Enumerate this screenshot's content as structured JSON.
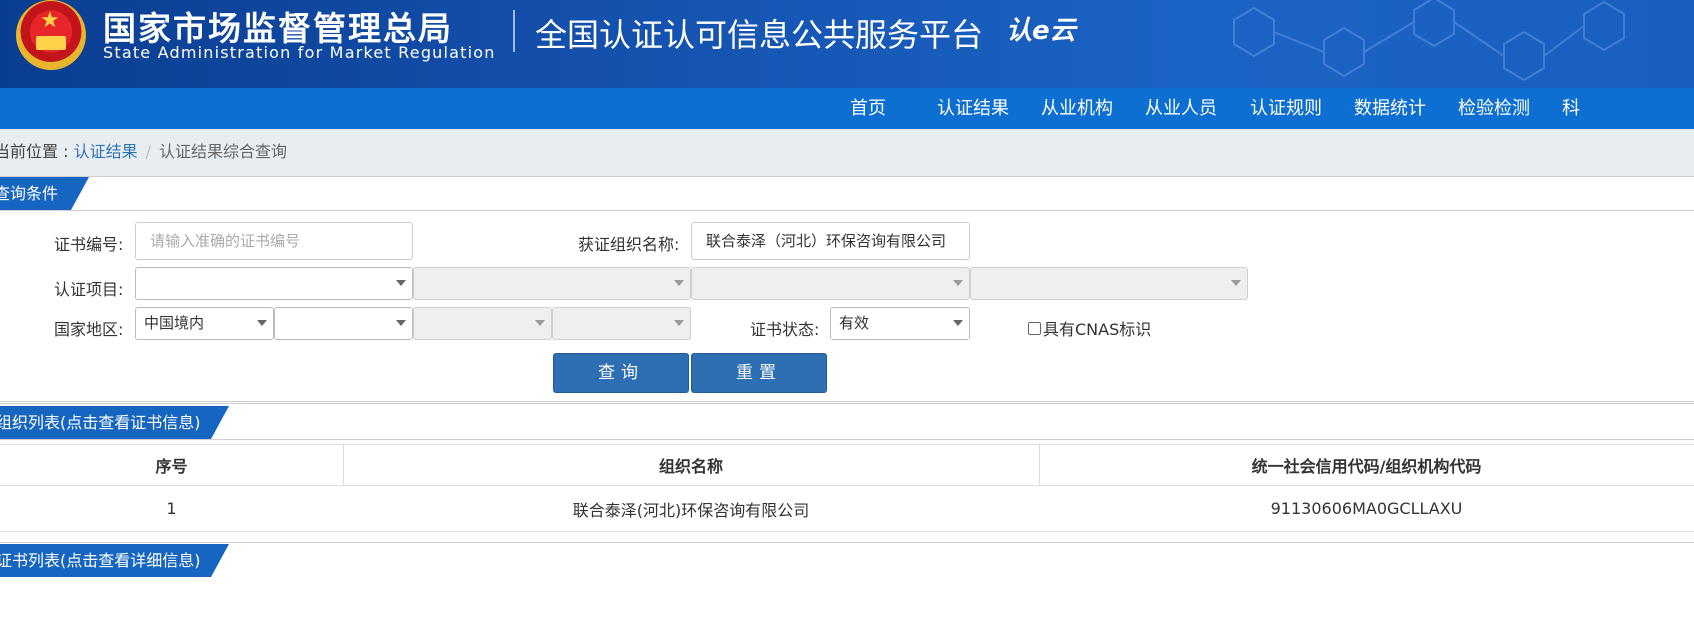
{
  "header": {
    "agency_cn": "国家市场监督管理总局",
    "agency_en": "State Administration  for  Market Regulation",
    "platform_title": "全国认证认可信息公共服务平台",
    "platform_logo": "认e云"
  },
  "nav": {
    "items": [
      "首页",
      "认证结果",
      "从业机构",
      "从业人员",
      "认证规则",
      "数据统计",
      "检验检测",
      "科"
    ]
  },
  "breadcrumb": {
    "prefix": "当前位置 : ",
    "link": "认证结果",
    "separator": "/",
    "current": "认证结果综合查询"
  },
  "query_section": {
    "tab": "查询条件",
    "cert_no_label": "证书编号:",
    "cert_no_placeholder": "请输入准确的证书编号",
    "cert_no_value": "",
    "org_name_label": "获证组织名称:",
    "org_name_value": "联合泰泽（河北）环保咨询有限公司",
    "project_label": "认证项目:",
    "project_selects": [
      "",
      "",
      "",
      ""
    ],
    "region_label": "国家地区:",
    "region_selects": [
      "中国境内",
      "",
      "",
      ""
    ],
    "status_label": "证书状态:",
    "status_value": "有效",
    "cnas_label": "具有CNAS标识",
    "query_button": "查询",
    "reset_button": "重置"
  },
  "org_section": {
    "tab": "组织列表(点击查看证书信息)",
    "headers": [
      "序号",
      "组织名称",
      "统一社会信用代码/组织机构代码"
    ],
    "rows": [
      [
        "1",
        "联合泰泽(河北)环保咨询有限公司",
        "91130606MA0GCLLAXU"
      ]
    ]
  },
  "cert_section": {
    "tab": "证书列表(点击查看详细信息)"
  },
  "colors": {
    "banner": "#1553b0",
    "nav": "#0d6fd1",
    "tab": "#1666c1",
    "button": "#2e6fb3",
    "link": "#2f73b7"
  }
}
